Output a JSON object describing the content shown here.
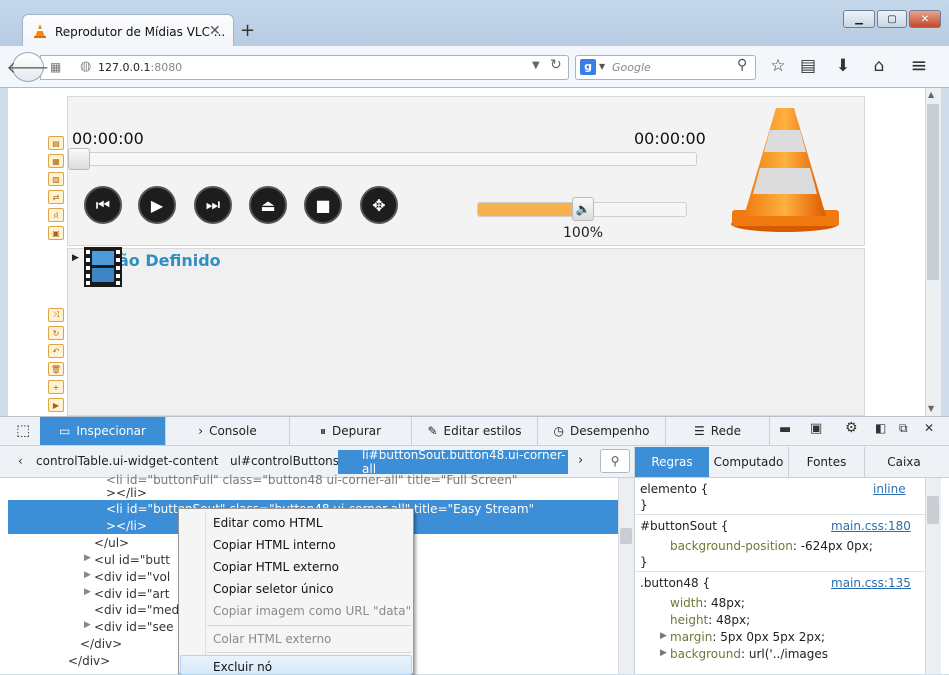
{
  "browser": {
    "tab_title": "Reprodutor de Mídias VLC ...",
    "url": "127.0.0.1",
    "url_port": ":8080",
    "search_placeholder": "Google",
    "new_tab": "+"
  },
  "player": {
    "time_elapsed": "00:00:00",
    "time_total": "00:00:00",
    "volume_percent": 100,
    "volume_label": "100%",
    "playlist_title": "ão Definido",
    "accent_color": "#f7b14f"
  },
  "devtools": {
    "tabs": [
      "Inspecionar",
      "Console",
      "Depurar",
      "Editar estilos",
      "Desempenho",
      "Rede"
    ],
    "breadcrumbs": [
      "controlTable.ui-widget-content",
      "ul#controlButtons",
      "li#buttonSout.button48.ui-corner-all"
    ],
    "rule_tabs": [
      "Regras",
      "Computado",
      "Fontes",
      "Caixa"
    ],
    "html_lines": [
      "<li id=\"buttonFull\" class=\"button48 ui-corner-all\" title=\"Full Screen\"",
      "></li>",
      "<li id=\"buttonSout\" class=\"button48 ui-corner-all\" title=\"Easy Stream\"",
      "></li>",
      "</ul>",
      "<ul id=\"butt",
      "<div id=\"vol",
      "<div id=\"art",
      "<div id=\"med",
      "<div id=\"see",
      "</div>",
      "</div>"
    ],
    "rules": {
      "element_selector": "elemento {",
      "element_src": "inline",
      "close": "}",
      "r1_selector": "#buttonSout {",
      "r1_src": "main.css:180",
      "r1_prop": "background-position",
      "r1_val": "-624px 0px;",
      "r2_selector": ".button48 {",
      "r2_src": "main.css:135",
      "r2_props": [
        {
          "prop": "width",
          "val": "48px;"
        },
        {
          "prop": "height",
          "val": "48px;"
        },
        {
          "prop": "margin",
          "val": "5px 0px 5px 2px;"
        },
        {
          "prop": "background",
          "val": "url('../images"
        }
      ]
    }
  },
  "context_menu": {
    "items": [
      {
        "label": "Editar como HTML",
        "disabled": false
      },
      {
        "label": "Copiar HTML interno",
        "disabled": false
      },
      {
        "label": "Copiar HTML externo",
        "disabled": false
      },
      {
        "label": "Copiar seletor único",
        "disabled": false
      },
      {
        "label": "Copiar imagem como URL \"data\"",
        "disabled": true
      },
      {
        "label": "Colar HTML externo",
        "disabled": true
      },
      {
        "label": "Excluir nó",
        "disabled": false
      }
    ]
  }
}
